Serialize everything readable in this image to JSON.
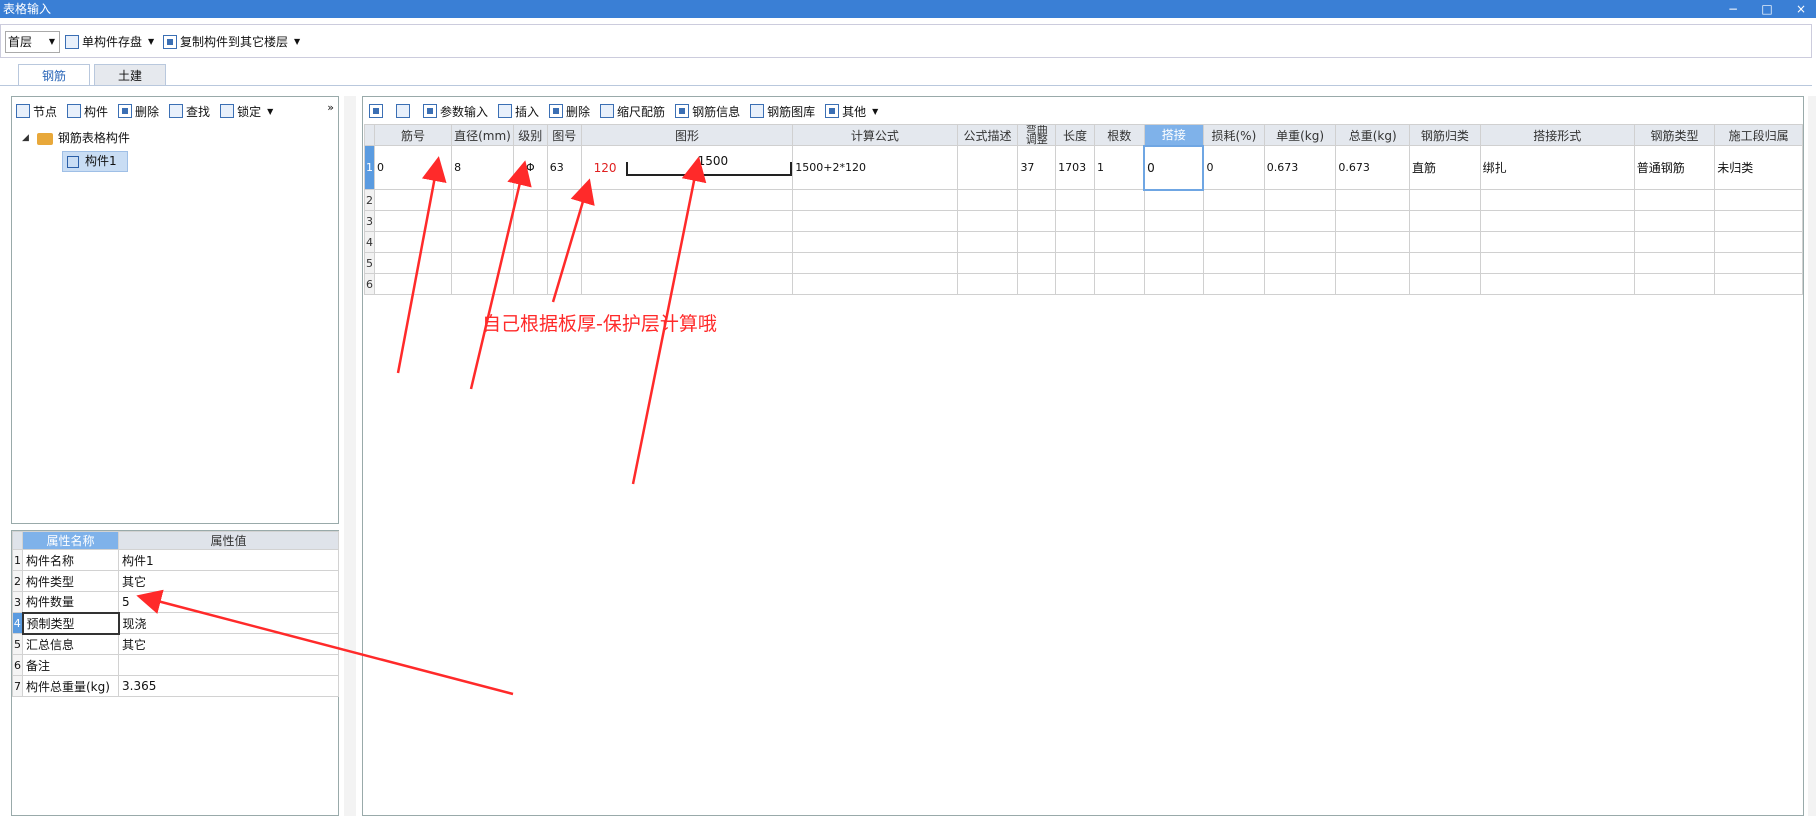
{
  "window": {
    "title": "表格输入",
    "min": "−",
    "max": "□",
    "close": "×"
  },
  "toolbar": {
    "floor": "首层",
    "save_single": "单构件存盘",
    "copy_to_floor": "复制构件到其它楼层"
  },
  "tabs": [
    {
      "label": "钢筋"
    },
    {
      "label": "土建"
    }
  ],
  "left_toolbar": {
    "node": "节点",
    "component": "构件",
    "delete": "删除",
    "find": "查找",
    "lock": "锁定",
    "collapse": "»"
  },
  "tree": {
    "root": "钢筋表格构件",
    "child": "构件1"
  },
  "props": {
    "header_name": "属性名称",
    "header_value": "属性值",
    "rows": [
      {
        "n": "1",
        "name": "构件名称",
        "value": "构件1"
      },
      {
        "n": "2",
        "name": "构件类型",
        "value": "其它"
      },
      {
        "n": "3",
        "name": "构件数量",
        "value": "5"
      },
      {
        "n": "4",
        "name": "预制类型",
        "value": "现浇"
      },
      {
        "n": "5",
        "name": "汇总信息",
        "value": "其它"
      },
      {
        "n": "6",
        "name": "备注",
        "value": ""
      },
      {
        "n": "7",
        "name": "构件总重量(kg)",
        "value": "3.365"
      }
    ]
  },
  "right_toolbar": {
    "param_input": "参数输入",
    "insert": "插入",
    "delete": "删除",
    "scale_rebar": "缩尺配筋",
    "rebar_info": "钢筋信息",
    "rebar_lib": "钢筋图库",
    "other": "其他"
  },
  "grid": {
    "headers": [
      "筋号",
      "直径(mm)",
      "级别",
      "图号",
      "图形",
      "计算公式",
      "公式描述",
      "弯曲调整",
      "长度",
      "根数",
      "搭接",
      "损耗(%)",
      "单重(kg)",
      "总重(kg)",
      "钢筋归类",
      "搭接形式",
      "钢筋类型",
      "施工段归属"
    ],
    "row1": {
      "n": "1",
      "jinhao": "0",
      "diameter": "8",
      "grade": "Φ",
      "figno": "63",
      "shape_left": "120",
      "shape_len": "1500",
      "formula": "1500+2*120",
      "formula_desc": "",
      "bend": "37",
      "length": "1703",
      "count": "1",
      "lap": "0",
      "loss": "0",
      "unit_weight": "0.673",
      "total_weight": "0.673",
      "category": "直筋",
      "lap_type": "绑扎",
      "rebar_type": "普通钢筋",
      "segment": "未归类"
    },
    "empty_rows": [
      "2",
      "3",
      "4",
      "5",
      "6"
    ]
  },
  "annotation": "自己根据板厚-保护层计算哦",
  "colors": {
    "titlebar": "#3a7fd5",
    "selected_header": "#7fb2ea",
    "annotation": "#ff2a2a"
  }
}
